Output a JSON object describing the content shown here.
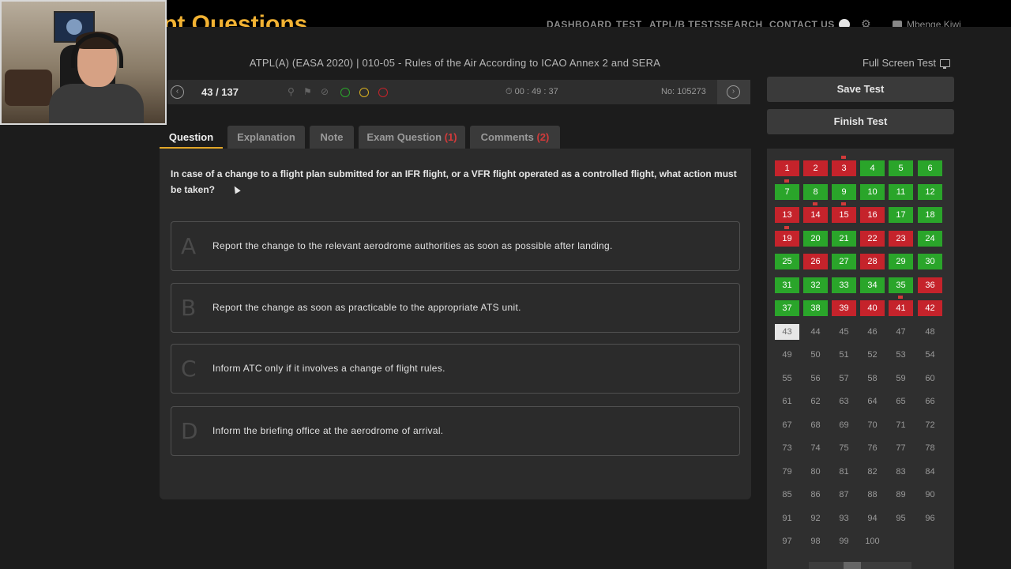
{
  "header": {
    "logo": "pt Questions",
    "nav": [
      "DASHBOARD",
      "TEST",
      "ATPL/B TESTS",
      "SEARCH",
      "CONTACT US"
    ],
    "user": "Mbenge.Kiwi"
  },
  "test": {
    "title": "ATPL(A) (EASA 2020) | 010-05 - Rules of the Air According to ICAO Annex 2 and SERA",
    "fullscreen_label": "Full Screen Test",
    "counter": "43 / 137",
    "timer": "00 : 49 : 37",
    "question_no": "No: 105273"
  },
  "icons": {
    "prev": "chevron-left-icon",
    "next": "chevron-right-icon",
    "pin": "pin-icon",
    "flag": "flag-icon",
    "clear": "ban-icon",
    "green_ring": "green-mark-icon",
    "yellow_ring": "yellow-mark-icon",
    "red_ring": "red-mark-icon",
    "timer": "clock-icon",
    "fullscreen": "monitor-icon"
  },
  "colors": {
    "correct": "#2aa52a",
    "wrong": "#c5232b",
    "accent": "#e2a728",
    "mark_green": "#2aa52a",
    "mark_yellow": "#d8b020",
    "mark_red": "#c5232b"
  },
  "sidebar": {
    "save": "Save Test",
    "finish": "Finish Test"
  },
  "tabs": [
    {
      "label": "Question",
      "count": ""
    },
    {
      "label": "Explanation",
      "count": ""
    },
    {
      "label": "Note",
      "count": ""
    },
    {
      "label": "Exam Question",
      "count": "(1)"
    },
    {
      "label": "Comments",
      "count": "(2)"
    }
  ],
  "question": {
    "text": "In case of a change to a flight plan submitted for an IFR flight, or a VFR flight operated as a controlled flight, what action must be taken?",
    "answers": [
      {
        "letter": "A",
        "text": "Report the change to the relevant aerodrome authorities as soon as possible after landing."
      },
      {
        "letter": "B",
        "text": "Report the change as soon as practicable to the appropriate ATS unit."
      },
      {
        "letter": "C",
        "text": "Inform ATC only if it involves a change of flight rules."
      },
      {
        "letter": "D",
        "text": "Inform the briefing office at the aerodrome of arrival."
      }
    ]
  },
  "grid": {
    "total": 100,
    "current": 43,
    "wrong": [
      1,
      2,
      3,
      13,
      14,
      15,
      16,
      19,
      22,
      23,
      26,
      28,
      36,
      39,
      40,
      41,
      42
    ],
    "correct": [
      4,
      5,
      6,
      7,
      8,
      9,
      10,
      11,
      12,
      17,
      18,
      20,
      21,
      24,
      25,
      27,
      29,
      30,
      31,
      32,
      33,
      34,
      35,
      37,
      38
    ],
    "flagged": [
      3,
      7,
      14,
      15,
      19,
      41
    ]
  }
}
